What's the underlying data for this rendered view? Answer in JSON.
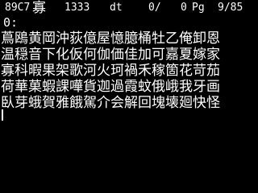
{
  "status": {
    "code": "89C7",
    "char": "寡",
    "count": "1333",
    "mode": "dt",
    "slash": "0/",
    "zero": "0",
    "pg": "Pg",
    "page": "9/85"
  },
  "prompt": "0:",
  "rows": [
    "蔦鴎黄岡沖荻億屋憶臆桶牡乙俺卸恩",
    "温穏音下化仮何伽価佳加可嘉夏嫁家",
    "寡科暇果架歌河火珂禍禾稼箇花苛茄",
    "荷華菓蝦課嘩貨迦過霞蚊俄峨我牙画",
    "臥芽蛾賀雅餓駕介会解回塊壊廻快怪"
  ],
  "colors": {
    "background": "#000000",
    "foreground": "#ffffff"
  }
}
